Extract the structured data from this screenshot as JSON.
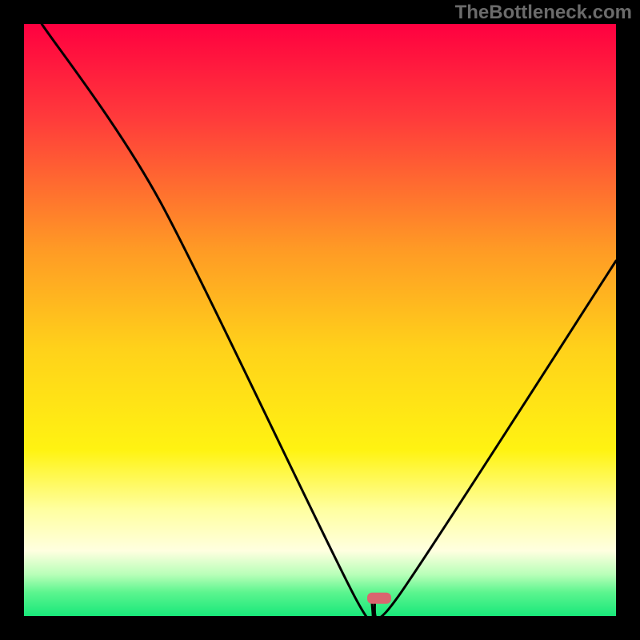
{
  "watermark": "TheBottleneck.com",
  "chart_data": {
    "type": "line",
    "title": "",
    "xlabel": "",
    "ylabel": "",
    "xlim": [
      0,
      100
    ],
    "ylim": [
      0,
      100
    ],
    "x": [
      3,
      23,
      56,
      59,
      63,
      100
    ],
    "values": [
      100,
      70,
      3,
      3,
      3,
      60
    ],
    "marker": {
      "x": 60,
      "y": 3,
      "color": "#d9666f"
    },
    "gradient_stops": [
      {
        "offset": 0,
        "color": "#ff0040"
      },
      {
        "offset": 16,
        "color": "#ff3b3b"
      },
      {
        "offset": 38,
        "color": "#ff9a25"
      },
      {
        "offset": 55,
        "color": "#ffd21a"
      },
      {
        "offset": 72,
        "color": "#fff312"
      },
      {
        "offset": 82,
        "color": "#ffffa0"
      },
      {
        "offset": 89,
        "color": "#ffffe0"
      },
      {
        "offset": 93,
        "color": "#b8ffb8"
      },
      {
        "offset": 96,
        "color": "#5cf58f"
      },
      {
        "offset": 100,
        "color": "#19e87a"
      }
    ],
    "border_color": "#000000",
    "border_width": 30,
    "line_color": "#000000",
    "line_width": 3
  }
}
